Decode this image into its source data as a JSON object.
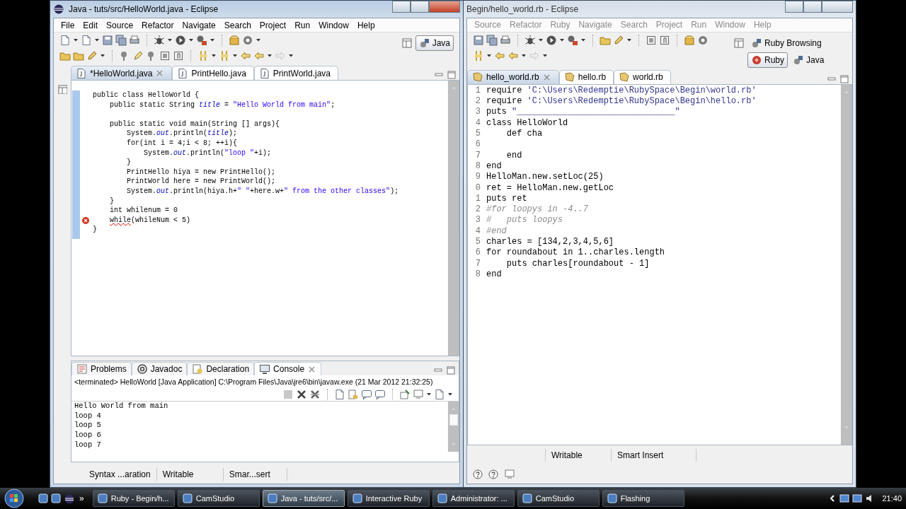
{
  "left_window": {
    "title": "Java - tuts/src/HelloWorld.java - Eclipse",
    "active": true,
    "app_icon": true,
    "menu": [
      "File",
      "Edit",
      "Source",
      "Refactor",
      "Navigate",
      "Search",
      "Project",
      "Run",
      "Window",
      "Help"
    ],
    "perspectives": [
      {
        "label": "Java",
        "selected": true
      }
    ],
    "editor_tabs": [
      {
        "label": "*HelloWorld.java",
        "selected": true
      },
      {
        "label": "PrintHello.java",
        "selected": false
      },
      {
        "label": "PrintWorld.java",
        "selected": false
      }
    ],
    "code_lines": [
      {
        "kind": "code",
        "error": false,
        "segments": [
          {
            "kind": "plain",
            "text": "public class HelloWorld {"
          }
        ]
      },
      {
        "kind": "code",
        "error": false,
        "segments": [
          {
            "kind": "plain",
            "text": "    public static String "
          },
          {
            "kind": "field",
            "text": "title"
          },
          {
            "kind": "plain",
            "text": " = "
          },
          {
            "kind": "string",
            "text": "\"Hello World from main\""
          },
          {
            "kind": "plain",
            "text": ";"
          }
        ]
      },
      {
        "kind": "blank",
        "error": false
      },
      {
        "kind": "code",
        "error": false,
        "segments": [
          {
            "kind": "plain",
            "text": "    public static void main(String [] args){"
          }
        ]
      },
      {
        "kind": "code",
        "error": false,
        "segments": [
          {
            "kind": "plain",
            "text": "        System."
          },
          {
            "kind": "field",
            "text": "out"
          },
          {
            "kind": "plain",
            "text": ".println("
          },
          {
            "kind": "field",
            "text": "title"
          },
          {
            "kind": "plain",
            "text": ");"
          }
        ]
      },
      {
        "kind": "code",
        "error": false,
        "segments": [
          {
            "kind": "plain",
            "text": "        for(int i = 4;i < 8; ++i){"
          }
        ]
      },
      {
        "kind": "code",
        "error": false,
        "segments": [
          {
            "kind": "plain",
            "text": "            System."
          },
          {
            "kind": "field",
            "text": "out"
          },
          {
            "kind": "plain",
            "text": ".println("
          },
          {
            "kind": "string",
            "text": "\"loop \""
          },
          {
            "kind": "plain",
            "text": "+i);"
          }
        ]
      },
      {
        "kind": "code",
        "error": false,
        "segments": [
          {
            "kind": "plain",
            "text": "        }"
          }
        ]
      },
      {
        "kind": "code",
        "error": false,
        "segments": [
          {
            "kind": "plain",
            "text": "        PrintHello hiya = new PrintHello();"
          }
        ]
      },
      {
        "kind": "code",
        "error": false,
        "segments": [
          {
            "kind": "plain",
            "text": "        PrintWorld here = new PrintWorld();"
          }
        ]
      },
      {
        "kind": "code",
        "error": false,
        "segments": [
          {
            "kind": "plain",
            "text": "        System."
          },
          {
            "kind": "field",
            "text": "out"
          },
          {
            "kind": "plain",
            "text": ".println(hiya.h+"
          },
          {
            "kind": "string",
            "text": "\" \""
          },
          {
            "kind": "plain",
            "text": "+here.w+"
          },
          {
            "kind": "string",
            "text": "\" from the other classes\""
          },
          {
            "kind": "plain",
            "text": ");"
          }
        ]
      },
      {
        "kind": "code",
        "error": false,
        "segments": [
          {
            "kind": "plain",
            "text": "    }"
          }
        ]
      },
      {
        "kind": "code",
        "error": false,
        "segments": [
          {
            "kind": "plain",
            "text": "    int whilenum = 0"
          }
        ]
      },
      {
        "kind": "code",
        "error": true,
        "segments": [
          {
            "kind": "error",
            "text": "    while"
          },
          {
            "kind": "plain",
            "text": "(whileNum < 5)"
          }
        ]
      },
      {
        "kind": "code",
        "error": false,
        "segments": [
          {
            "kind": "plain",
            "text": "}"
          }
        ]
      }
    ],
    "console_tabs": [
      {
        "label": "Problems",
        "selected": false
      },
      {
        "label": "Javadoc",
        "selected": false
      },
      {
        "label": "Declaration",
        "selected": false
      },
      {
        "label": "Console",
        "selected": true
      }
    ],
    "console_description": "<terminated> HelloWorld [Java Application] C:\\Program Files\\Java\\jre6\\bin\\javaw.exe (21 Mar 2012 21:32:25)",
    "console_output": [
      "Hello World from main",
      "loop 4",
      "loop 5",
      "loop 6",
      "loop 7"
    ],
    "status_bar": [
      "Syntax ...aration",
      "Writable",
      "Smar...sert"
    ]
  },
  "right_window": {
    "title": "Begin/hello_world.rb - Eclipse",
    "active": false,
    "menu": [
      "Source",
      "Refactor",
      "Ruby",
      "Navigate",
      "Search",
      "Project",
      "Run",
      "Window",
      "Help"
    ],
    "perspectives": [
      {
        "label": "Ruby Browsing",
        "selected": false
      },
      {
        "label": "Ruby",
        "selected": true
      },
      {
        "label": "Java",
        "selected": false
      }
    ],
    "editor_tabs": [
      {
        "label": "hello_world.rb",
        "selected": true
      },
      {
        "label": "hello.rb",
        "selected": false
      },
      {
        "label": "world.rb",
        "selected": false
      }
    ],
    "code_lines": [
      {
        "number": "1",
        "kind": "code",
        "segments": [
          {
            "kind": "plain",
            "text": "require "
          },
          {
            "kind": "string",
            "text": "'C:\\Users\\Redemptie\\RubySpace\\Begin\\world.rb'"
          }
        ]
      },
      {
        "number": "2",
        "kind": "code",
        "segments": [
          {
            "kind": "plain",
            "text": "require "
          },
          {
            "kind": "string",
            "text": "'C:\\Users\\Redemptie\\RubySpace\\Begin\\hello.rb'"
          }
        ]
      },
      {
        "number": "3",
        "kind": "code",
        "segments": [
          {
            "kind": "plain",
            "text": "puts "
          },
          {
            "kind": "string",
            "text": "\"_______________________________\""
          }
        ]
      },
      {
        "number": "4",
        "kind": "code",
        "segments": [
          {
            "kind": "plain",
            "text": "class HelloWorld"
          }
        ]
      },
      {
        "number": "5",
        "kind": "code",
        "segments": [
          {
            "kind": "plain",
            "text": "    def cha"
          }
        ]
      },
      {
        "number": "6",
        "kind": "blank"
      },
      {
        "number": "7",
        "kind": "code",
        "segments": [
          {
            "kind": "plain",
            "text": "    end"
          }
        ]
      },
      {
        "number": "8",
        "kind": "code",
        "segments": [
          {
            "kind": "plain",
            "text": "end"
          }
        ]
      },
      {
        "number": "9",
        "kind": "code",
        "segments": [
          {
            "kind": "plain",
            "text": "HelloMan.new.setLoc(25)"
          }
        ]
      },
      {
        "number": "0",
        "kind": "code",
        "segments": [
          {
            "kind": "plain",
            "text": "ret = HelloMan.new.getLoc"
          }
        ]
      },
      {
        "number": "1",
        "kind": "code",
        "segments": [
          {
            "kind": "plain",
            "text": "puts ret"
          }
        ]
      },
      {
        "number": "2",
        "kind": "code",
        "segments": [
          {
            "kind": "comment",
            "text": "#for loopys in -4..7"
          }
        ]
      },
      {
        "number": "3",
        "kind": "code",
        "segments": [
          {
            "kind": "comment",
            "text": "#   puts loopys"
          }
        ]
      },
      {
        "number": "4",
        "kind": "code",
        "segments": [
          {
            "kind": "comment",
            "text": "#end"
          }
        ]
      },
      {
        "number": "5",
        "kind": "code",
        "segments": [
          {
            "kind": "plain",
            "text": "charles = [134,2,3,4,5,6]"
          }
        ]
      },
      {
        "number": "6",
        "kind": "code",
        "segments": [
          {
            "kind": "plain",
            "text": "for roundabout in 1..charles.length"
          }
        ]
      },
      {
        "number": "7",
        "kind": "code",
        "segments": [
          {
            "kind": "plain",
            "text": "    puts charles[roundabout - 1]"
          }
        ]
      },
      {
        "number": "8",
        "kind": "code",
        "segments": [
          {
            "kind": "plain",
            "text": "end"
          }
        ]
      }
    ],
    "status_bar": [
      "Writable",
      "Smart Insert"
    ]
  },
  "taskbar": {
    "more": "»",
    "buttons": [
      {
        "label": "Ruby - Begin/h...",
        "selected": false
      },
      {
        "label": "CamStudio",
        "selected": false
      },
      {
        "label": "Java - tuts/src/...",
        "selected": true
      },
      {
        "label": "Interactive Ruby",
        "selected": false
      },
      {
        "label": "Administrator: ...",
        "selected": false
      },
      {
        "label": "CamStudio",
        "selected": false
      },
      {
        "label": "Flashing",
        "selected": false
      }
    ],
    "clock": "21:40"
  }
}
